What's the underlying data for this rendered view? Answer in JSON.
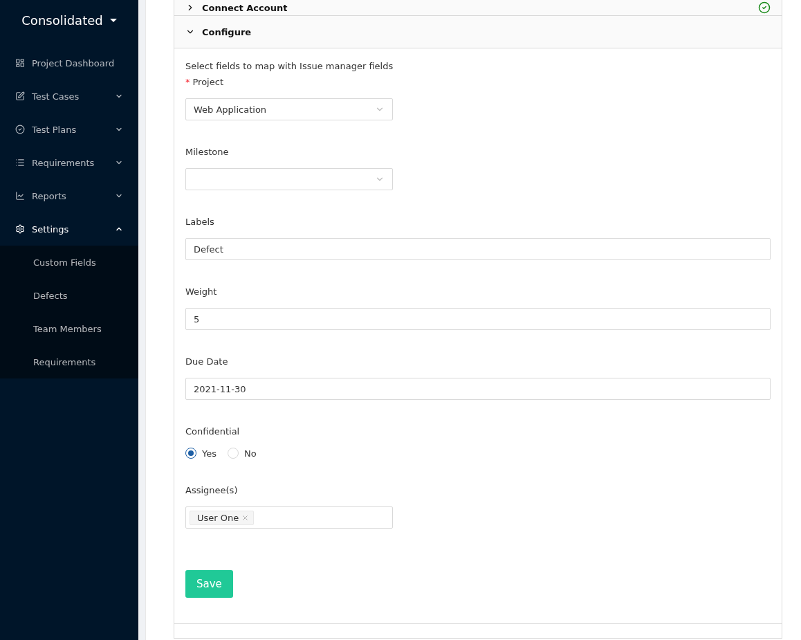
{
  "sidebar": {
    "title": "Consolidated",
    "items": [
      {
        "label": "Project Dashboard"
      },
      {
        "label": "Test Cases",
        "expanded": false
      },
      {
        "label": "Test Plans",
        "expanded": false
      },
      {
        "label": "Requirements",
        "expanded": false
      },
      {
        "label": "Reports",
        "expanded": false
      },
      {
        "label": "Settings",
        "expanded": true,
        "children": [
          {
            "label": "Custom Fields"
          },
          {
            "label": "Defects"
          },
          {
            "label": "Team Members"
          },
          {
            "label": "Requirements"
          }
        ]
      }
    ]
  },
  "panels": [
    {
      "title": "Connect Account",
      "expanded": false,
      "complete": true
    },
    {
      "title": "Configure",
      "expanded": true,
      "intro": "Select fields to map with Issue manager fields",
      "fields": [
        {
          "kind": "select",
          "label": "Project",
          "required_mark": "*",
          "value": "Web Application"
        },
        {
          "kind": "select",
          "label": "Milestone"
        },
        {
          "kind": "input",
          "label": "Labels",
          "value": "Defect"
        },
        {
          "kind": "input",
          "label": "Weight",
          "value": "5"
        },
        {
          "kind": "input",
          "label": "Due Date",
          "value": "2021-11-30"
        },
        {
          "kind": "radio",
          "label": "Confidential",
          "options": [
            {
              "label": "Yes",
              "selected": true
            },
            {
              "label": "No",
              "selected": false
            }
          ]
        },
        {
          "kind": "tags",
          "label": "Assignee(s)",
          "tags": [
            "User One"
          ]
        }
      ],
      "button": "Save"
    }
  ]
}
